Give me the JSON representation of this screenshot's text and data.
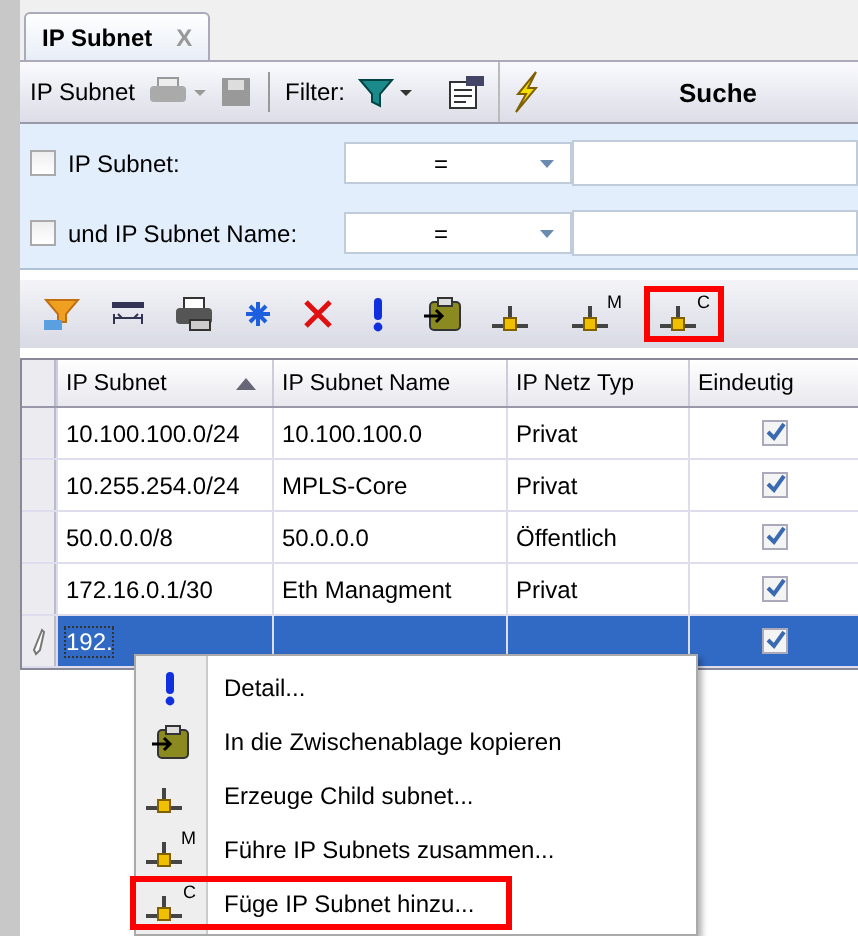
{
  "tab": {
    "label": "IP Subnet",
    "close": "X"
  },
  "toolbar": {
    "title": "IP Subnet",
    "filter_label": "Filter:",
    "search_label": "Suche"
  },
  "filters": [
    {
      "label": "IP Subnet:",
      "checked": false,
      "operator": "="
    },
    {
      "label": "und IP Subnet Name:",
      "checked": false,
      "operator": "="
    }
  ],
  "actions": [
    {
      "kind": "filter",
      "highlighted": false
    },
    {
      "kind": "columns",
      "highlighted": false
    },
    {
      "kind": "print",
      "highlighted": false
    },
    {
      "kind": "snow",
      "highlighted": false
    },
    {
      "kind": "delete",
      "highlighted": false
    },
    {
      "kind": "detail",
      "highlighted": false
    },
    {
      "kind": "clipboard",
      "highlighted": false
    },
    {
      "kind": "subnet",
      "highlighted": false
    },
    {
      "kind": "subnet",
      "badge": "M",
      "highlighted": false
    },
    {
      "kind": "subnet",
      "badge": "C",
      "highlighted": true
    }
  ],
  "table": {
    "columns": [
      {
        "label": "IP Subnet",
        "sorted": true
      },
      {
        "label": "IP Subnet Name",
        "sorted": false
      },
      {
        "label": "IP Netz Typ",
        "sorted": false
      },
      {
        "label": "Eindeutig",
        "sorted": false
      }
    ],
    "rows": [
      {
        "subnet": "10.100.100.0/24",
        "name": "10.100.100.0",
        "type": "Privat",
        "unique": true,
        "selected": false
      },
      {
        "subnet": "10.255.254.0/24",
        "name": "MPLS-Core",
        "type": "Privat",
        "unique": true,
        "selected": false
      },
      {
        "subnet": "50.0.0.0/8",
        "name": "50.0.0.0",
        "type": "Öffentlich",
        "unique": true,
        "selected": false
      },
      {
        "subnet": "172.16.0.1/30",
        "name": "Eth Managment",
        "type": "Privat",
        "unique": true,
        "selected": false
      },
      {
        "subnet": "192.",
        "unique": true,
        "selected": true
      }
    ]
  },
  "context_menu": [
    {
      "kind": "detail",
      "label": "Detail...",
      "highlighted": false
    },
    {
      "kind": "clipboard",
      "label": "In die Zwischenablage kopieren",
      "highlighted": false
    },
    {
      "kind": "subnet",
      "label": "Erzeuge Child subnet...",
      "highlighted": false
    },
    {
      "kind": "subnet",
      "badge": "M",
      "label": "Führe IP Subnets zusammen...",
      "highlighted": false
    },
    {
      "kind": "subnet",
      "badge": "C",
      "label": "Füge IP Subnet hinzu...",
      "highlighted": true
    }
  ]
}
